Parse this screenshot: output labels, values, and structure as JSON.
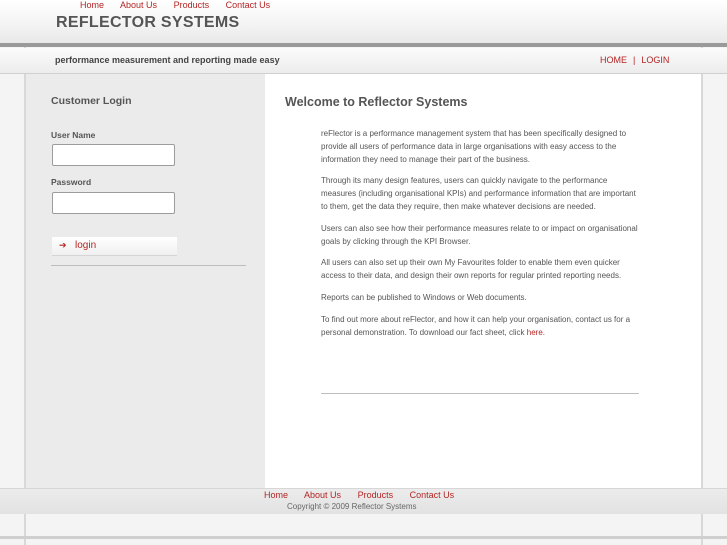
{
  "header": {
    "top_nav": [
      "Home",
      "About Us",
      "Products",
      "Contact Us"
    ],
    "brand": "REFLECTOR SYSTEMS"
  },
  "tagline_bar": {
    "tagline": "performance measurement and reporting made easy",
    "right_nav": {
      "home": "HOME",
      "separator": "|",
      "login": "LOGIN"
    }
  },
  "login": {
    "title": "Customer Login",
    "username_label": "User Name",
    "username_value": "",
    "password_label": "Password",
    "password_value": "",
    "button_label": "login",
    "button_icon": "arrow-right-icon"
  },
  "main": {
    "title": "Welcome to Reflector Systems",
    "paragraphs": [
      "reFlector is a performance management system that has been specifically designed to provide all users of performance data in large organisations with easy access to the information they need to manage their part of the business.",
      "Through its many design features, users can quickly navigate to the performance measures (including organisational KPIs) and performance information that are important to them, get the data they require, then make whatever decisions are needed.",
      "Users can also see how their performance measures relate to or impact on organisational goals by clicking through the KPI Browser.",
      "All users can also set up their own My Favourites folder to enable them even quicker access to their data, and design their own reports for regular printed reporting needs.",
      "Reports can be published to Windows or Web documents.",
      "To find out more about reFlector, and how it can help your organisation, contact us for a personal demonstration. To download our fact sheet, click"
    ],
    "link_text": "here",
    "link_suffix": "."
  },
  "footer": {
    "nav": [
      "Home",
      "About Us",
      "Products",
      "Contact Us"
    ],
    "copyright": "Copyright © 2009 Reflector Systems"
  },
  "colors": {
    "accent": "#b52424",
    "text": "#555555",
    "sidebar_bg": "#ebebeb",
    "header_bar": "#9a9a9a"
  }
}
